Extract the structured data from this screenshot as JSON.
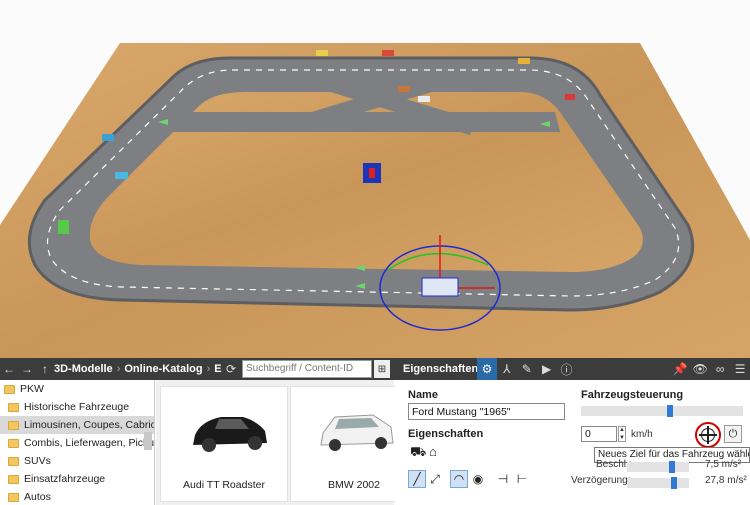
{
  "catalog": {
    "breadcrumb": [
      "3D-Modelle",
      "Online-Katalog",
      "E"
    ],
    "search_placeholder": "Suchbegriff / Content-ID",
    "tree": [
      {
        "label": "PKW",
        "root": true,
        "selected": false
      },
      {
        "label": "Historische Fahrzeuge",
        "root": false,
        "selected": false
      },
      {
        "label": "Limousinen, Coupes, Cabrios",
        "root": false,
        "selected": true
      },
      {
        "label": "Combis, Lieferwagen, Pickups",
        "root": false,
        "selected": false
      },
      {
        "label": "SUVs",
        "root": false,
        "selected": false
      },
      {
        "label": "Einsatzfahrzeuge",
        "root": false,
        "selected": false
      },
      {
        "label": "Autos",
        "root": false,
        "selected": false
      }
    ],
    "models": [
      {
        "label": "Audi TT Roadster",
        "color": "#1a1a1a"
      },
      {
        "label": "BMW 2002",
        "color": "#f2f2f2"
      }
    ]
  },
  "properties": {
    "header_title": "Eigenschaften",
    "name_label": "Name",
    "name_value": "Ford Mustang \"1965\"",
    "props_label": "Eigenschaften",
    "vehicle_control_label": "Fahrzeugsteuerung",
    "speed_value": "0",
    "speed_unit": "km/h",
    "speed_slider_fraction": 0.55,
    "tooltip": "Neues Ziel für das Fahrzeug wählen",
    "accel_label": "Beschl.:",
    "accel_value": "7,5 m/s²",
    "decel_label": "Verzögerung:",
    "decel_value": "27,8 m/s²",
    "accel_slider_fraction": 0.75,
    "decel_slider_fraction": 0.78
  },
  "colors": {
    "accent": "#2f7bd6",
    "highlight_ring": "#d00000"
  }
}
